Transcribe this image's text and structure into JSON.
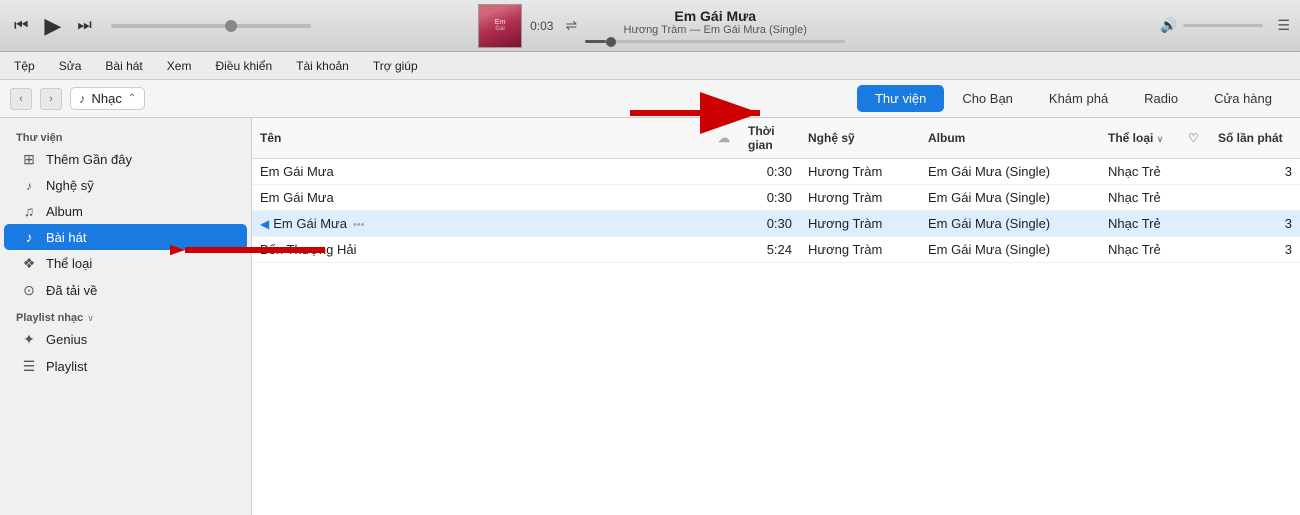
{
  "player": {
    "prev_label": "⏮",
    "play_label": "▶",
    "next_label": "⏭",
    "time": "0:03",
    "song_title": "Em Gái Mưa",
    "song_subtitle": "Hương Tràm — Em Gái Mưa (Single)",
    "shuffle_icon": "⇌"
  },
  "menu": {
    "items": [
      "Tệp",
      "Sửa",
      "Bài hát",
      "Xem",
      "Điều khiển",
      "Tài khoản",
      "Trợ giúp"
    ]
  },
  "navbar": {
    "back_label": "‹",
    "forward_label": "›",
    "music_icon": "♪",
    "music_label": "Nhạc",
    "dropdown_icon": "⌃"
  },
  "tabs": [
    {
      "label": "Thư viện",
      "active": true
    },
    {
      "label": "Cho Bạn",
      "active": false
    },
    {
      "label": "Khám phá",
      "active": false
    },
    {
      "label": "Radio",
      "active": false
    },
    {
      "label": "Cửa hàng",
      "active": false
    }
  ],
  "sidebar": {
    "library_title": "Thư viện",
    "items": [
      {
        "id": "them-gan-day",
        "icon": "⊞",
        "label": "Thêm Gần đây"
      },
      {
        "id": "nghe-si",
        "icon": "🎤",
        "label": "Nghệ sỹ"
      },
      {
        "id": "album",
        "icon": "♫",
        "label": "Album"
      },
      {
        "id": "bai-hat",
        "icon": "♪",
        "label": "Bài hát",
        "active": true
      },
      {
        "id": "the-loai",
        "icon": "🎸",
        "label": "Thể loại"
      },
      {
        "id": "da-tai-ve",
        "icon": "⊙",
        "label": "Đã tải về"
      }
    ],
    "playlist_title": "Playlist nhạc",
    "playlist_items": [
      {
        "id": "genius",
        "icon": "✨",
        "label": "Genius"
      },
      {
        "id": "playlist",
        "icon": "☰",
        "label": "Playlist"
      }
    ]
  },
  "table": {
    "headers": [
      {
        "id": "name",
        "label": "Tên"
      },
      {
        "id": "cloud",
        "label": "☁"
      },
      {
        "id": "time",
        "label": "Thời gian"
      },
      {
        "id": "artist",
        "label": "Nghệ sỹ"
      },
      {
        "id": "album",
        "label": "Album"
      },
      {
        "id": "genre",
        "label": "Thể loại"
      },
      {
        "id": "heart",
        "label": "♡"
      },
      {
        "id": "plays",
        "label": "Số lần phát"
      }
    ],
    "rows": [
      {
        "id": 1,
        "name": "Em Gái Mưa",
        "playing": false,
        "time": "0:30",
        "artist": "Hương Tràm",
        "album": "Em Gái Mưa (Single)",
        "genre": "Nhạc Trẻ",
        "plays": "3"
      },
      {
        "id": 2,
        "name": "Em Gái Mưa",
        "playing": false,
        "time": "0:30",
        "artist": "Hương Tràm",
        "album": "Em Gái Mưa (Single)",
        "genre": "Nhạc Trẻ",
        "plays": ""
      },
      {
        "id": 3,
        "name": "Em Gái Mưa",
        "playing": true,
        "time": "0:30",
        "artist": "Hương Tràm",
        "album": "Em Gái Mưa (Single)",
        "genre": "Nhạc Trẻ",
        "plays": "3"
      },
      {
        "id": 4,
        "name": "Bến Thượng Hải",
        "playing": false,
        "time": "5:24",
        "artist": "Hương Tràm",
        "album": "Em Gái Mưa (Single)",
        "genre": "Nhạc Trẻ",
        "plays": "3"
      }
    ]
  }
}
